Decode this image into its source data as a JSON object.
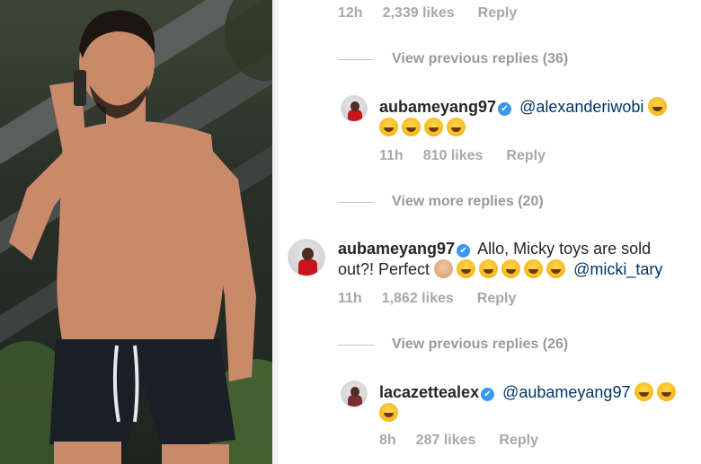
{
  "photo": {
    "colors": {
      "skin": "#c98a6a",
      "shorts": "#1a1e27",
      "drawstring": "#e8e8e8",
      "hair": "#1c1512"
    }
  },
  "comments": {
    "top_meta": {
      "time": "12h",
      "likes": "2,339 likes",
      "reply": "Reply"
    },
    "view_previous_1": "View previous replies (36)",
    "comment_1": {
      "username": "aubameyang97",
      "verified_icon": "✔",
      "mention": "@alexanderiwobi",
      "emojis": [
        "face-with-tears-of-joy",
        "face-with-tears-of-joy",
        "face-with-tears-of-joy",
        "face-with-tears-of-joy",
        "face-with-tears-of-joy"
      ],
      "meta": {
        "time": "11h",
        "likes": "810 likes",
        "reply": "Reply"
      }
    },
    "view_more": "View more replies (20)",
    "comment_2": {
      "username": "aubameyang97",
      "verified_icon": "✔",
      "text_1": "Allo, Micky toys are sold",
      "text_2": "out?! Perfect",
      "mention": "@micki_tary",
      "emojis": [
        "ok-hand",
        "grimacing-face",
        "face-with-tears-of-joy",
        "face-with-tears-of-joy",
        "face-with-tears-of-joy",
        "face-with-tears-of-joy"
      ],
      "meta": {
        "time": "11h",
        "likes": "1,862 likes",
        "reply": "Reply"
      }
    },
    "view_previous_2": "View previous replies (26)",
    "comment_3": {
      "username": "lacazettealex",
      "verified_icon": "✔",
      "mention": "@aubameyang97",
      "emojis": [
        "face-with-tears-of-joy",
        "face-with-tears-of-joy",
        "face-with-tears-of-joy"
      ],
      "meta": {
        "time": "8h",
        "likes": "287 likes",
        "reply": "Reply"
      }
    },
    "colors": {
      "text": "#262626",
      "meta": "#a8a8a8",
      "mention": "#003569",
      "verified": "#3897f0"
    }
  }
}
